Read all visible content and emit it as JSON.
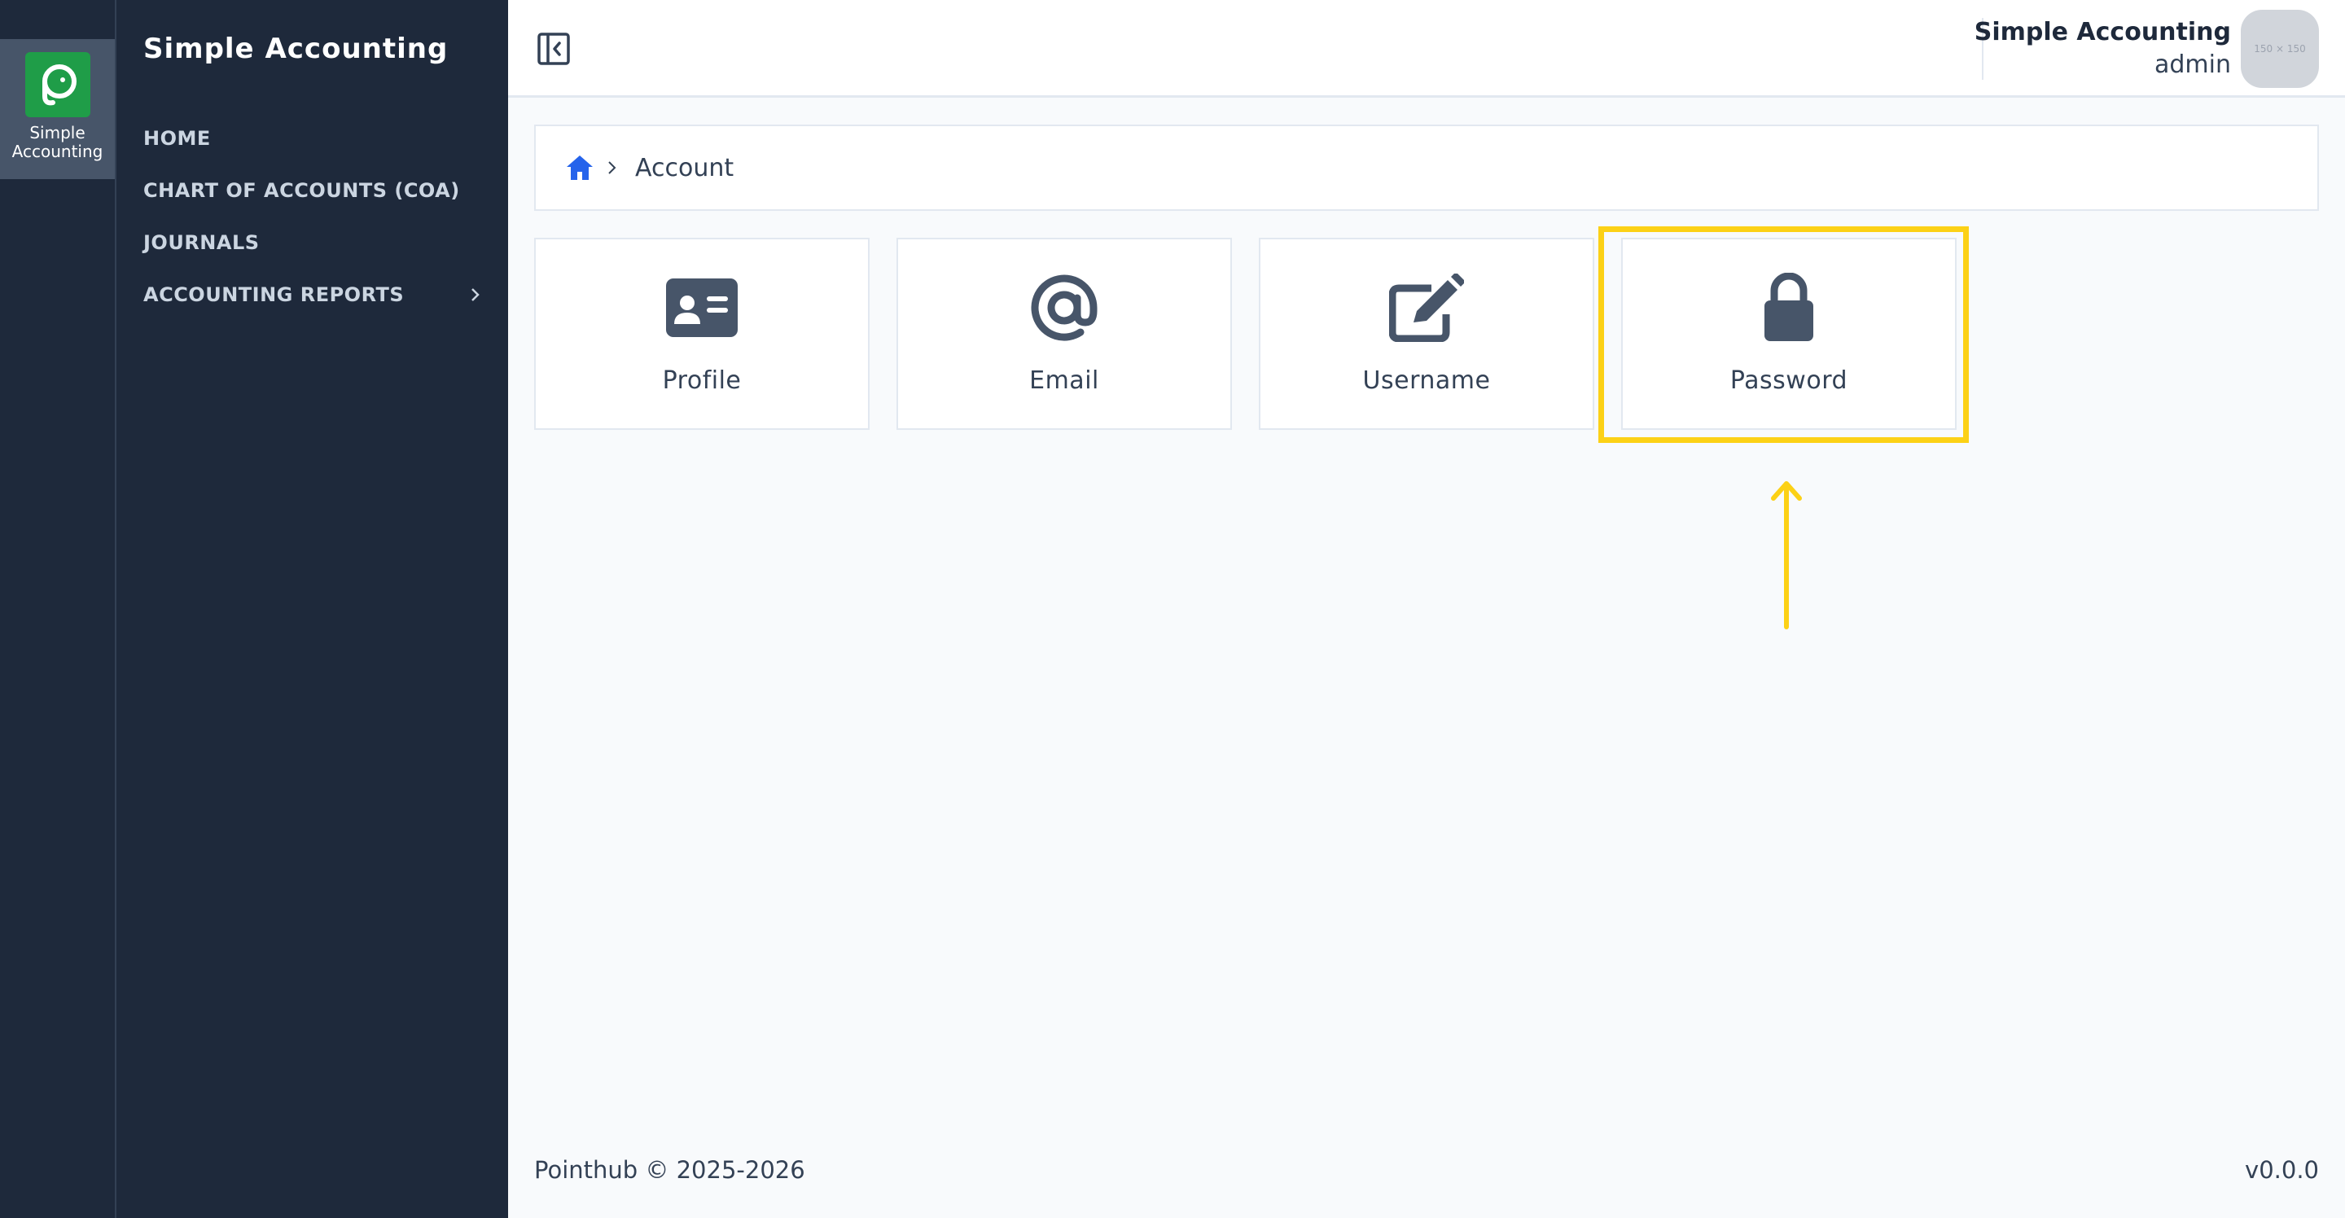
{
  "rail": {
    "app_label": "Simple Accounting"
  },
  "sidebar": {
    "brand": "Simple Accounting",
    "items": [
      {
        "label": "HOME"
      },
      {
        "label": "CHART OF ACCOUNTS (COA)"
      },
      {
        "label": "JOURNALS"
      },
      {
        "label": "ACCOUNTING REPORTS"
      }
    ]
  },
  "topbar": {
    "org_name": "Simple Accounting",
    "user_role": "admin",
    "avatar_placeholder": "150 × 150"
  },
  "breadcrumb": {
    "current": "Account"
  },
  "cards": [
    {
      "label": "Profile",
      "icon": "id-card-icon"
    },
    {
      "label": "Email",
      "icon": "at-sign-icon"
    },
    {
      "label": "Username",
      "icon": "edit-icon"
    },
    {
      "label": "Password",
      "icon": "lock-icon"
    }
  ],
  "footer": {
    "copyright": "Pointhub © 2025-2026",
    "version": "v0.0.0"
  },
  "colors": {
    "sidebar_bg": "#1e293b",
    "accent_blue": "#2563eb",
    "logo_green": "#1f9d48",
    "highlight_yellow": "#fcd116",
    "icon_slate": "#475569"
  }
}
